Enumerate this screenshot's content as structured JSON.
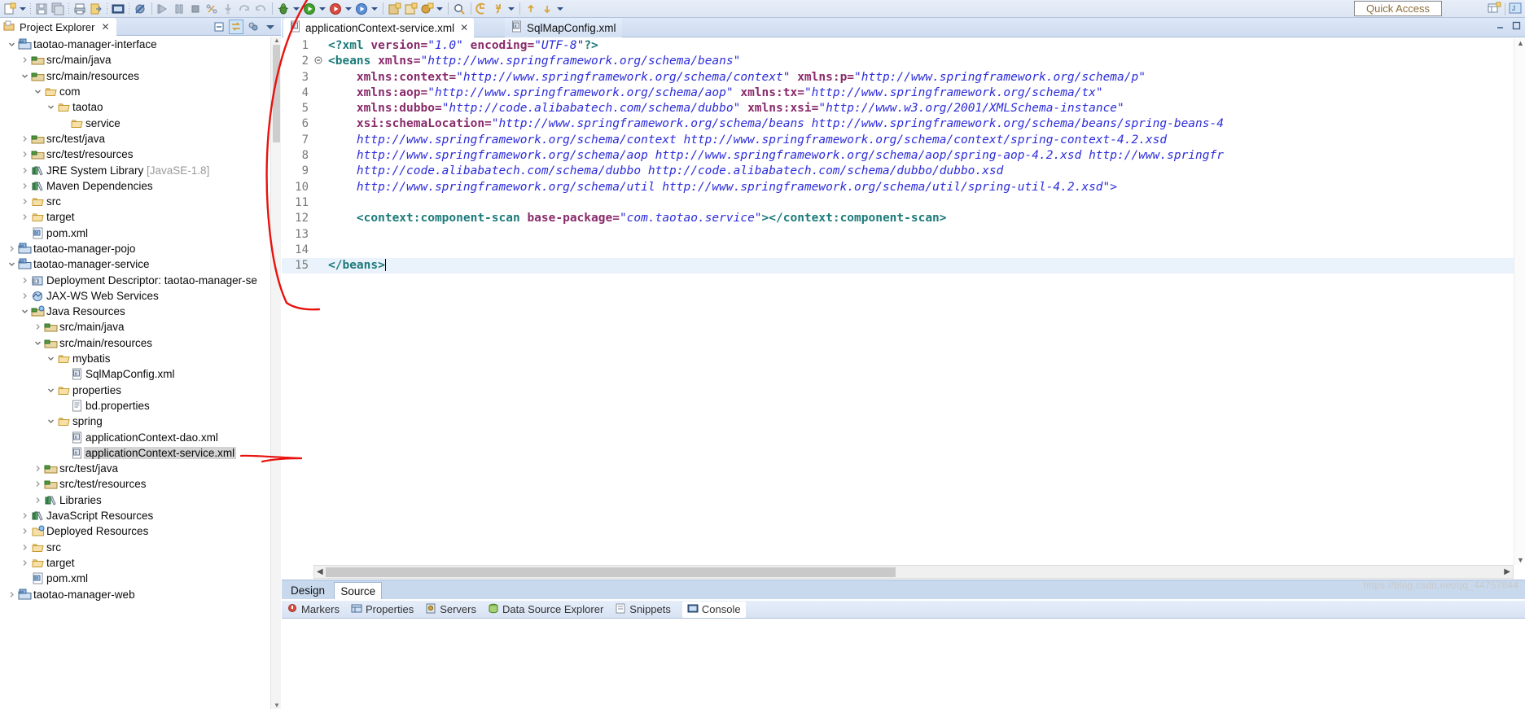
{
  "window": {
    "quick_access": "Quick Access"
  },
  "toolbar": {
    "items": [
      {
        "name": "new-wizard-icon",
        "glyph": "new"
      },
      {
        "name": "new-dropdown-icon",
        "glyph": "caret"
      },
      {
        "name": "separator",
        "glyph": "sep"
      },
      {
        "name": "save-icon",
        "glyph": "save"
      },
      {
        "name": "save-all-icon",
        "glyph": "saveall"
      },
      {
        "name": "separator",
        "glyph": "sep"
      },
      {
        "name": "print-icon",
        "glyph": "print"
      },
      {
        "name": "export-icon",
        "glyph": "export"
      },
      {
        "name": "separator",
        "glyph": "sep"
      },
      {
        "name": "console-icon",
        "glyph": "console"
      },
      {
        "name": "separator",
        "glyph": "sep"
      },
      {
        "name": "skip-breakpoints-icon",
        "glyph": "skipbp"
      },
      {
        "name": "divider",
        "glyph": "bar"
      },
      {
        "name": "resume-icon",
        "glyph": "resume"
      },
      {
        "name": "suspend-icon",
        "glyph": "suspend"
      },
      {
        "name": "terminate-icon",
        "glyph": "terminate"
      },
      {
        "name": "disconnect-icon",
        "glyph": "disconnect"
      },
      {
        "name": "step-into-icon",
        "glyph": "stepinto"
      },
      {
        "name": "step-over-icon",
        "glyph": "stepover"
      },
      {
        "name": "step-return-icon",
        "glyph": "stepreturn"
      },
      {
        "name": "divider",
        "glyph": "bar"
      },
      {
        "name": "debug-icon",
        "glyph": "debug"
      },
      {
        "name": "debug-dropdown-icon",
        "glyph": "caret"
      },
      {
        "name": "run-icon",
        "glyph": "run"
      },
      {
        "name": "run-dropdown-icon",
        "glyph": "caret"
      },
      {
        "name": "run-external-tools-icon",
        "glyph": "exttools"
      },
      {
        "name": "ext-dropdown-icon",
        "glyph": "caret"
      },
      {
        "name": "coverage-icon",
        "glyph": "coverage"
      },
      {
        "name": "coverage-dropdown-icon",
        "glyph": "caret"
      },
      {
        "name": "divider",
        "glyph": "bar"
      },
      {
        "name": "new-java-project-icon",
        "glyph": "newjava"
      },
      {
        "name": "new-package-icon",
        "glyph": "newpkg"
      },
      {
        "name": "new-class-icon",
        "glyph": "newclass"
      },
      {
        "name": "new-class-dropdown-icon",
        "glyph": "caret"
      },
      {
        "name": "divider",
        "glyph": "bar"
      },
      {
        "name": "search-icon",
        "glyph": "search"
      },
      {
        "name": "divider",
        "glyph": "bar"
      },
      {
        "name": "back-icon",
        "glyph": "back"
      },
      {
        "name": "forward-icon",
        "glyph": "forward"
      },
      {
        "name": "nav-dropdown-icon",
        "glyph": "caret"
      },
      {
        "name": "divider",
        "glyph": "bar"
      },
      {
        "name": "prev-annotation-icon",
        "glyph": "prevann"
      },
      {
        "name": "next-annotation-icon",
        "glyph": "nextann"
      },
      {
        "name": "ann-dropdown-icon",
        "glyph": "caret"
      }
    ],
    "right_items": [
      {
        "name": "open-perspective-icon",
        "glyph": "persp"
      },
      {
        "name": "perspective-java-icon",
        "glyph": "javapersp"
      }
    ]
  },
  "project_explorer": {
    "tab_label": "Project Explorer",
    "close_label": "✕",
    "tools": [
      {
        "name": "collapse-all-icon",
        "glyph": "collapse"
      },
      {
        "name": "link-with-editor-icon",
        "glyph": "link",
        "selected": true
      },
      {
        "name": "view-menu-filter-icon",
        "glyph": "filter"
      },
      {
        "name": "view-menu-icon",
        "glyph": "vmenu"
      }
    ],
    "tree": [
      {
        "indent": 0,
        "arrow": "down",
        "icon": "maven-project",
        "label": "taotao-manager-interface"
      },
      {
        "indent": 1,
        "arrow": "right",
        "icon": "source-folder",
        "label": "src/main/java"
      },
      {
        "indent": 1,
        "arrow": "down",
        "icon": "source-folder",
        "label": "src/main/resources"
      },
      {
        "indent": 2,
        "arrow": "down",
        "icon": "folder",
        "label": "com"
      },
      {
        "indent": 3,
        "arrow": "down",
        "icon": "folder",
        "label": "taotao"
      },
      {
        "indent": 4,
        "arrow": "none",
        "icon": "folder",
        "label": "service"
      },
      {
        "indent": 1,
        "arrow": "right",
        "icon": "source-folder",
        "label": "src/test/java"
      },
      {
        "indent": 1,
        "arrow": "right",
        "icon": "source-folder",
        "label": "src/test/resources"
      },
      {
        "indent": 1,
        "arrow": "right",
        "icon": "library",
        "label": "JRE System Library",
        "suffix": "[JavaSE-1.8]"
      },
      {
        "indent": 1,
        "arrow": "right",
        "icon": "library",
        "label": "Maven Dependencies"
      },
      {
        "indent": 1,
        "arrow": "right",
        "icon": "folder",
        "label": "src"
      },
      {
        "indent": 1,
        "arrow": "right",
        "icon": "folder",
        "label": "target"
      },
      {
        "indent": 1,
        "arrow": "none",
        "icon": "pom",
        "label": "pom.xml"
      },
      {
        "indent": 0,
        "arrow": "right",
        "icon": "maven-project",
        "label": "taotao-manager-pojo"
      },
      {
        "indent": 0,
        "arrow": "down",
        "icon": "maven-project",
        "label": "taotao-manager-service"
      },
      {
        "indent": 1,
        "arrow": "right",
        "icon": "deployment",
        "label": "Deployment Descriptor: taotao-manager-se"
      },
      {
        "indent": 1,
        "arrow": "right",
        "icon": "jaxws",
        "label": "JAX-WS Web Services"
      },
      {
        "indent": 1,
        "arrow": "down",
        "icon": "java-resources",
        "label": "Java Resources"
      },
      {
        "indent": 2,
        "arrow": "right",
        "icon": "source-folder",
        "label": "src/main/java"
      },
      {
        "indent": 2,
        "arrow": "down",
        "icon": "source-folder",
        "label": "src/main/resources"
      },
      {
        "indent": 3,
        "arrow": "down",
        "icon": "folder",
        "label": "mybatis"
      },
      {
        "indent": 4,
        "arrow": "none",
        "icon": "xml-file",
        "label": "SqlMapConfig.xml"
      },
      {
        "indent": 3,
        "arrow": "down",
        "icon": "folder",
        "label": "properties"
      },
      {
        "indent": 4,
        "arrow": "none",
        "icon": "properties-file",
        "label": "bd.properties"
      },
      {
        "indent": 3,
        "arrow": "down",
        "icon": "folder",
        "label": "spring"
      },
      {
        "indent": 4,
        "arrow": "none",
        "icon": "xml-file",
        "label": "applicationContext-dao.xml"
      },
      {
        "indent": 4,
        "arrow": "none",
        "icon": "xml-file",
        "label": "applicationContext-service.xml",
        "selected": true
      },
      {
        "indent": 2,
        "arrow": "right",
        "icon": "source-folder",
        "label": "src/test/java"
      },
      {
        "indent": 2,
        "arrow": "right",
        "icon": "source-folder",
        "label": "src/test/resources"
      },
      {
        "indent": 2,
        "arrow": "right",
        "icon": "library",
        "label": "Libraries"
      },
      {
        "indent": 1,
        "arrow": "right",
        "icon": "library",
        "label": "JavaScript Resources"
      },
      {
        "indent": 1,
        "arrow": "right",
        "icon": "deployed-resources",
        "label": "Deployed Resources"
      },
      {
        "indent": 1,
        "arrow": "right",
        "icon": "folder",
        "label": "src"
      },
      {
        "indent": 1,
        "arrow": "right",
        "icon": "folder",
        "label": "target"
      },
      {
        "indent": 1,
        "arrow": "none",
        "icon": "pom",
        "label": "pom.xml"
      },
      {
        "indent": 0,
        "arrow": "right",
        "icon": "maven-project",
        "label": "taotao-manager-web"
      }
    ]
  },
  "editor": {
    "tabs": [
      {
        "label": "applicationContext-service.xml",
        "icon": "xml-file",
        "active": true,
        "close": "✕"
      },
      {
        "label": "SqlMapConfig.xml",
        "icon": "xml-file",
        "active": false
      }
    ],
    "window_buttons": [
      {
        "name": "minimize-button",
        "glyph": "–"
      },
      {
        "name": "maximize-button",
        "glyph": "▭"
      }
    ],
    "bottom_tabs": [
      {
        "label": "Design",
        "active": false
      },
      {
        "label": "Source",
        "active": true
      }
    ],
    "lines": [
      {
        "n": 1,
        "fold": "",
        "cur": false,
        "segments": [
          {
            "t": "<?xml ",
            "c": "pi"
          },
          {
            "t": "version=",
            "c": "at"
          },
          {
            "t": "\"1.0\"",
            "c": "va"
          },
          {
            "t": " ",
            "c": "at"
          },
          {
            "t": "encoding=",
            "c": "at"
          },
          {
            "t": "\"UTF-8\"",
            "c": "va"
          },
          {
            "t": "?>",
            "c": "pi"
          }
        ]
      },
      {
        "n": 2,
        "fold": "minus",
        "cur": false,
        "segments": [
          {
            "t": "<beans ",
            "c": "tg"
          },
          {
            "t": "xmlns=",
            "c": "at"
          },
          {
            "t": "\"http://www.springframework.org/schema/beans\"",
            "c": "va"
          }
        ]
      },
      {
        "n": 3,
        "fold": "",
        "cur": false,
        "segments": [
          {
            "t": "    ",
            "c": "tg"
          },
          {
            "t": "xmlns:context=",
            "c": "at"
          },
          {
            "t": "\"http://www.springframework.org/schema/context\"",
            "c": "va"
          },
          {
            "t": " ",
            "c": "at"
          },
          {
            "t": "xmlns:p=",
            "c": "at"
          },
          {
            "t": "\"http://www.springframework.org/schema/p\"",
            "c": "va"
          }
        ]
      },
      {
        "n": 4,
        "fold": "",
        "cur": false,
        "segments": [
          {
            "t": "    ",
            "c": "tg"
          },
          {
            "t": "xmlns:aop=",
            "c": "at"
          },
          {
            "t": "\"http://www.springframework.org/schema/aop\"",
            "c": "va"
          },
          {
            "t": " ",
            "c": "at"
          },
          {
            "t": "xmlns:tx=",
            "c": "at"
          },
          {
            "t": "\"http://www.springframework.org/schema/tx\"",
            "c": "va"
          }
        ]
      },
      {
        "n": 5,
        "fold": "",
        "cur": false,
        "segments": [
          {
            "t": "    ",
            "c": "tg"
          },
          {
            "t": "xmlns:dubbo=",
            "c": "at"
          },
          {
            "t": "\"http://code.alibabatech.com/schema/dubbo\"",
            "c": "va"
          },
          {
            "t": " ",
            "c": "at"
          },
          {
            "t": "xmlns:xsi=",
            "c": "at"
          },
          {
            "t": "\"http://www.w3.org/2001/XMLSchema-instance\"",
            "c": "va"
          }
        ]
      },
      {
        "n": 6,
        "fold": "",
        "cur": false,
        "segments": [
          {
            "t": "    ",
            "c": "tg"
          },
          {
            "t": "xsi:schemaLocation=",
            "c": "at"
          },
          {
            "t": "\"http://www.springframework.org/schema/beans http://www.springframework.org/schema/beans/spring-beans-4",
            "c": "va"
          }
        ]
      },
      {
        "n": 7,
        "fold": "",
        "cur": false,
        "segments": [
          {
            "t": "    http://www.springframework.org/schema/context http://www.springframework.org/schema/context/spring-context-4.2.xsd",
            "c": "va"
          }
        ]
      },
      {
        "n": 8,
        "fold": "",
        "cur": false,
        "segments": [
          {
            "t": "    http://www.springframework.org/schema/aop http://www.springframework.org/schema/aop/spring-aop-4.2.xsd http://www.springfr",
            "c": "va"
          }
        ]
      },
      {
        "n": 9,
        "fold": "",
        "cur": false,
        "segments": [
          {
            "t": "    http://code.alibabatech.com/schema/dubbo http://code.alibabatech.com/schema/dubbo/dubbo.xsd",
            "c": "va"
          }
        ]
      },
      {
        "n": 10,
        "fold": "",
        "cur": false,
        "segments": [
          {
            "t": "    http://www.springframework.org/schema/util http://www.springframework.org/schema/util/spring-util-4.2.xsd\">",
            "c": "va"
          }
        ]
      },
      {
        "n": 11,
        "fold": "",
        "cur": false,
        "segments": []
      },
      {
        "n": 12,
        "fold": "",
        "cur": false,
        "segments": [
          {
            "t": "    <context:component-scan ",
            "c": "tg"
          },
          {
            "t": "base-package=",
            "c": "at"
          },
          {
            "t": "\"com.taotao.service\"",
            "c": "va"
          },
          {
            "t": "></context:component-scan>",
            "c": "tg"
          }
        ]
      },
      {
        "n": 13,
        "fold": "",
        "cur": false,
        "segments": []
      },
      {
        "n": 14,
        "fold": "",
        "cur": false,
        "segments": []
      },
      {
        "n": 15,
        "fold": "",
        "cur": true,
        "segments": [
          {
            "t": "</beans>",
            "c": "tg"
          }
        ],
        "caret": true
      }
    ]
  },
  "bottom_views": {
    "tabs": [
      {
        "label": "Markers",
        "icon": "markers-icon",
        "active": false
      },
      {
        "label": "Properties",
        "icon": "properties-icon",
        "active": false
      },
      {
        "label": "Servers",
        "icon": "servers-icon",
        "active": false
      },
      {
        "label": "Data Source Explorer",
        "icon": "datasource-icon",
        "active": false
      },
      {
        "label": "Snippets",
        "icon": "snippets-icon",
        "active": false
      },
      {
        "label": "Console",
        "icon": "console-icon",
        "active": true
      }
    ]
  },
  "watermark": "https://blog.csdn.net/qq_44757844",
  "colors": {
    "tag": "#1d7a7a",
    "attribute": "#8a2b6b",
    "value": "#2c2cdb",
    "current_line": "#eaf2fb",
    "selection": "#d4d4d4",
    "annotation": "#e8120e",
    "toolbar_bg": "#dce5f3"
  }
}
